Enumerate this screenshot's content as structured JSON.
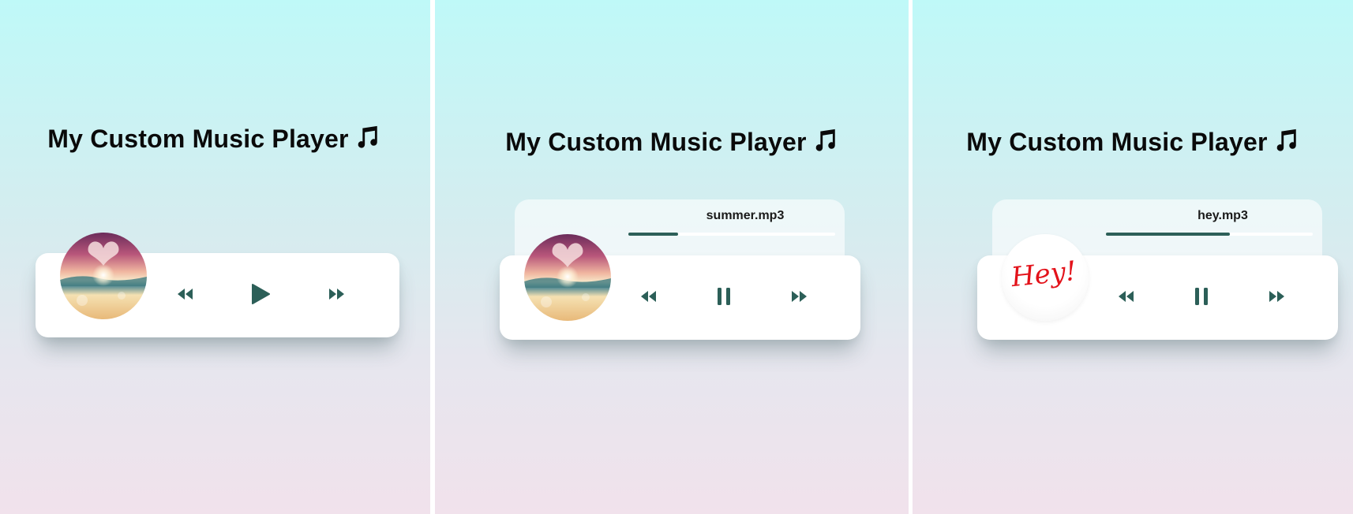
{
  "title": "My Custom Music Player",
  "colors": {
    "accent": "#2c5f58",
    "title": "#0a0a0a"
  },
  "icons": {
    "note": "music-note-icon",
    "prev": "backward-icon",
    "next": "forward-icon",
    "play": "play-icon",
    "pause": "pause-icon"
  },
  "players": [
    {
      "state": "paused",
      "track": "",
      "progress": 0,
      "cover": "summer-cover"
    },
    {
      "state": "playing",
      "track": "summer.mp3",
      "progress": 0.24,
      "cover": "summer-cover"
    },
    {
      "state": "playing",
      "track": "hey.mp3",
      "progress": 0.6,
      "cover": "hey-cover",
      "cover_text": "Hey!"
    }
  ]
}
